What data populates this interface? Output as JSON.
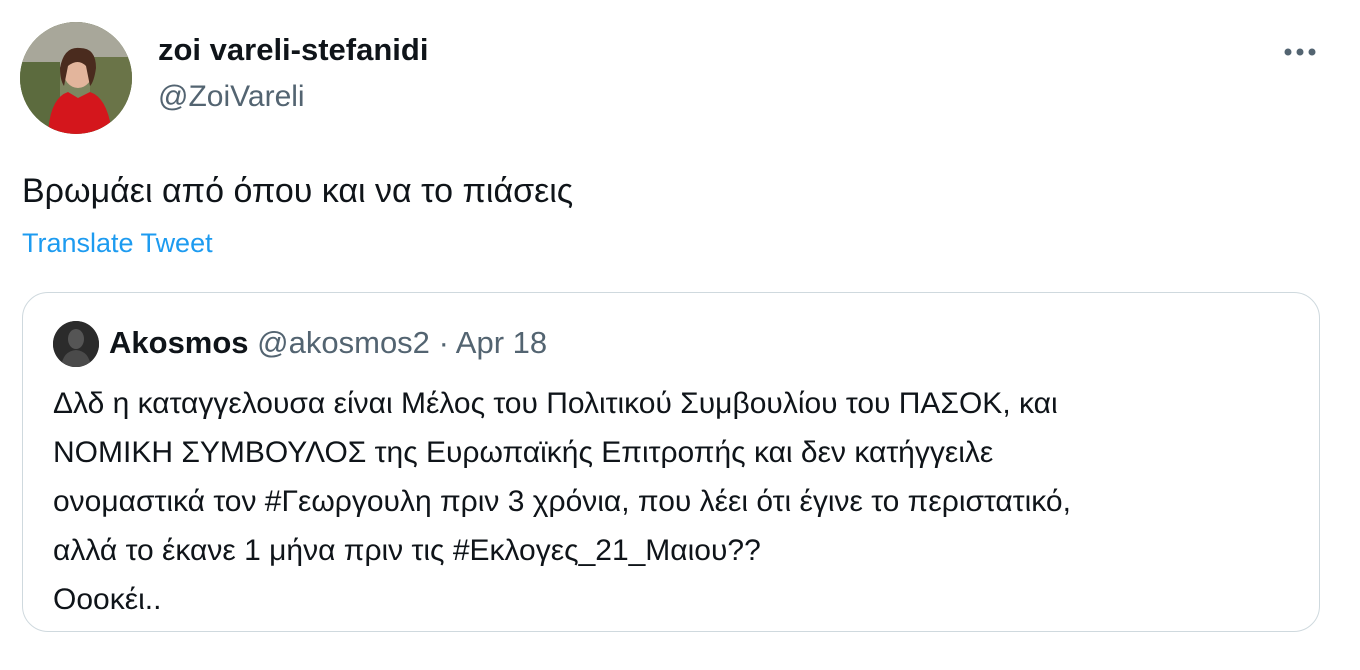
{
  "tweet": {
    "author_name": "zoi vareli-stefanidi",
    "author_handle": "@ZoiVareli",
    "text": "Βρωμάει από όπου και να το πιάσεις",
    "translate_label": "Translate Tweet",
    "more_icon": "more-horizontal-icon",
    "quoted": {
      "author_name": "Akosmos",
      "author_handle": "@akosmos2",
      "separator": "·",
      "date": "Apr 18",
      "lines": [
        "Δλδ η καταγγελουσα είναι Μέλος του Πολιτικού Συμβουλίου του ΠΑΣΟΚ, και",
        "ΝΟΜΙΚΗ ΣΥΜΒΟΥΛΟΣ της Ευρωπαϊκής Επιτροπής και δεν κατήγγειλε",
        "ονομαστικά τον #Γεωργουλη πριν 3 χρόνια, που λέει ότι έγινε το περιστατικό,",
        "αλλά το έκανε 1 μήνα πριν τις #Εκλογες_21_Μαιου??",
        "Οοοκέι.."
      ]
    }
  },
  "colors": {
    "text": "#0f1419",
    "secondary": "#536471",
    "link": "#1d9bf0",
    "border": "#cfd9de"
  }
}
